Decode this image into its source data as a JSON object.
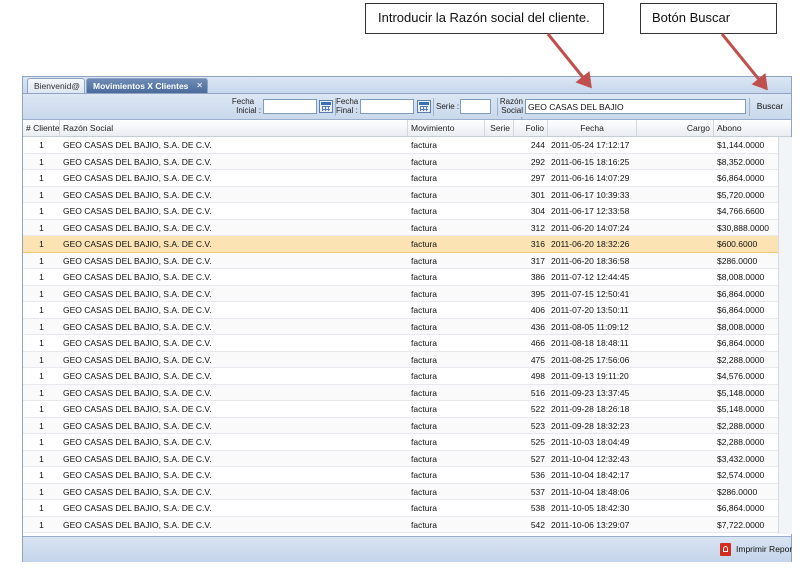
{
  "callouts": {
    "razon_hint": "Introducir la Razón social del cliente.",
    "buscar_hint": "Botón Buscar"
  },
  "tabs": [
    {
      "label": "Bienvenid@"
    },
    {
      "label": "Movimientos X Clientes",
      "close": "✕"
    }
  ],
  "toolbar": {
    "fecha_inicial_label": [
      "Fecha",
      "Inicial :"
    ],
    "fecha_final_label": [
      "Fecha",
      "Final :"
    ],
    "serie_label": "Serie :",
    "razon_label": [
      "Razón",
      "Social :"
    ],
    "fecha_inicial_value": "",
    "fecha_final_value": "",
    "serie_value": "",
    "razon_value": "GEO CASAS DEL BAJIO",
    "buscar_label": "Buscar"
  },
  "columns": {
    "cliente": "# Cliente",
    "razon": "Razón Social",
    "movimiento": "Movimiento",
    "serie": "Serie",
    "folio": "Folio",
    "fecha": "Fecha",
    "cargo": "Cargo",
    "abono": "Abono"
  },
  "rows": [
    {
      "cliente": "1",
      "razon": "GEO CASAS DEL BAJIO, S.A. DE C.V.",
      "movimiento": "factura",
      "serie": "",
      "folio": "244",
      "fecha": "2011-05-24 17:12:17",
      "cargo": "",
      "abono": "$1,144.0000"
    },
    {
      "cliente": "1",
      "razon": "GEO CASAS DEL BAJIO, S.A. DE C.V.",
      "movimiento": "factura",
      "serie": "",
      "folio": "292",
      "fecha": "2011-06-15 18:16:25",
      "cargo": "",
      "abono": "$8,352.0000"
    },
    {
      "cliente": "1",
      "razon": "GEO CASAS DEL BAJIO, S.A. DE C.V.",
      "movimiento": "factura",
      "serie": "",
      "folio": "297",
      "fecha": "2011-06-16 14:07:29",
      "cargo": "",
      "abono": "$6,864.0000"
    },
    {
      "cliente": "1",
      "razon": "GEO CASAS DEL BAJIO, S.A. DE C.V.",
      "movimiento": "factura",
      "serie": "",
      "folio": "301",
      "fecha": "2011-06-17 10:39:33",
      "cargo": "",
      "abono": "$5,720.0000"
    },
    {
      "cliente": "1",
      "razon": "GEO CASAS DEL BAJIO, S.A. DE C.V.",
      "movimiento": "factura",
      "serie": "",
      "folio": "304",
      "fecha": "2011-06-17 12:33:58",
      "cargo": "",
      "abono": "$4,766.6600"
    },
    {
      "cliente": "1",
      "razon": "GEO CASAS DEL BAJIO, S.A. DE C.V.",
      "movimiento": "factura",
      "serie": "",
      "folio": "312",
      "fecha": "2011-06-20 14:07:24",
      "cargo": "",
      "abono": "$30,888.0000"
    },
    {
      "cliente": "1",
      "razon": "GEO CASAS DEL BAJIO, S.A. DE C.V.",
      "movimiento": "factura",
      "serie": "",
      "folio": "316",
      "fecha": "2011-06-20 18:32:26",
      "cargo": "",
      "abono": "$600.6000",
      "selected": true
    },
    {
      "cliente": "1",
      "razon": "GEO CASAS DEL BAJIO, S.A. DE C.V.",
      "movimiento": "factura",
      "serie": "",
      "folio": "317",
      "fecha": "2011-06-20 18:36:58",
      "cargo": "",
      "abono": "$286.0000"
    },
    {
      "cliente": "1",
      "razon": "GEO CASAS DEL BAJIO, S.A. DE C.V.",
      "movimiento": "factura",
      "serie": "",
      "folio": "386",
      "fecha": "2011-07-12 12:44:45",
      "cargo": "",
      "abono": "$8,008.0000"
    },
    {
      "cliente": "1",
      "razon": "GEO CASAS DEL BAJIO, S.A. DE C.V.",
      "movimiento": "factura",
      "serie": "",
      "folio": "395",
      "fecha": "2011-07-15 12:50:41",
      "cargo": "",
      "abono": "$6,864.0000"
    },
    {
      "cliente": "1",
      "razon": "GEO CASAS DEL BAJIO, S.A. DE C.V.",
      "movimiento": "factura",
      "serie": "",
      "folio": "406",
      "fecha": "2011-07-20 13:50:11",
      "cargo": "",
      "abono": "$6,864.0000"
    },
    {
      "cliente": "1",
      "razon": "GEO CASAS DEL BAJIO, S.A. DE C.V.",
      "movimiento": "factura",
      "serie": "",
      "folio": "436",
      "fecha": "2011-08-05 11:09:12",
      "cargo": "",
      "abono": "$8,008.0000"
    },
    {
      "cliente": "1",
      "razon": "GEO CASAS DEL BAJIO, S.A. DE C.V.",
      "movimiento": "factura",
      "serie": "",
      "folio": "466",
      "fecha": "2011-08-18 18:48:11",
      "cargo": "",
      "abono": "$6,864.0000"
    },
    {
      "cliente": "1",
      "razon": "GEO CASAS DEL BAJIO, S.A. DE C.V.",
      "movimiento": "factura",
      "serie": "",
      "folio": "475",
      "fecha": "2011-08-25 17:56:06",
      "cargo": "",
      "abono": "$2,288.0000"
    },
    {
      "cliente": "1",
      "razon": "GEO CASAS DEL BAJIO, S.A. DE C.V.",
      "movimiento": "factura",
      "serie": "",
      "folio": "498",
      "fecha": "2011-09-13 19:11:20",
      "cargo": "",
      "abono": "$4,576.0000"
    },
    {
      "cliente": "1",
      "razon": "GEO CASAS DEL BAJIO, S.A. DE C.V.",
      "movimiento": "factura",
      "serie": "",
      "folio": "516",
      "fecha": "2011-09-23 13:37:45",
      "cargo": "",
      "abono": "$5,148.0000"
    },
    {
      "cliente": "1",
      "razon": "GEO CASAS DEL BAJIO, S.A. DE C.V.",
      "movimiento": "factura",
      "serie": "",
      "folio": "522",
      "fecha": "2011-09-28 18:26:18",
      "cargo": "",
      "abono": "$5,148.0000"
    },
    {
      "cliente": "1",
      "razon": "GEO CASAS DEL BAJIO, S.A. DE C.V.",
      "movimiento": "factura",
      "serie": "",
      "folio": "523",
      "fecha": "2011-09-28 18:32:23",
      "cargo": "",
      "abono": "$2,288.0000"
    },
    {
      "cliente": "1",
      "razon": "GEO CASAS DEL BAJIO, S.A. DE C.V.",
      "movimiento": "factura",
      "serie": "",
      "folio": "525",
      "fecha": "2011-10-03 18:04:49",
      "cargo": "",
      "abono": "$2,288.0000"
    },
    {
      "cliente": "1",
      "razon": "GEO CASAS DEL BAJIO, S.A. DE C.V.",
      "movimiento": "factura",
      "serie": "",
      "folio": "527",
      "fecha": "2011-10-04 12:32:43",
      "cargo": "",
      "abono": "$3,432.0000"
    },
    {
      "cliente": "1",
      "razon": "GEO CASAS DEL BAJIO, S.A. DE C.V.",
      "movimiento": "factura",
      "serie": "",
      "folio": "536",
      "fecha": "2011-10-04 18:42:17",
      "cargo": "",
      "abono": "$2,574.0000"
    },
    {
      "cliente": "1",
      "razon": "GEO CASAS DEL BAJIO, S.A. DE C.V.",
      "movimiento": "factura",
      "serie": "",
      "folio": "537",
      "fecha": "2011-10-04 18:48:06",
      "cargo": "",
      "abono": "$286.0000"
    },
    {
      "cliente": "1",
      "razon": "GEO CASAS DEL BAJIO, S.A. DE C.V.",
      "movimiento": "factura",
      "serie": "",
      "folio": "538",
      "fecha": "2011-10-05 18:42:30",
      "cargo": "",
      "abono": "$6,864.0000"
    },
    {
      "cliente": "1",
      "razon": "GEO CASAS DEL BAJIO, S.A. DE C.V.",
      "movimiento": "factura",
      "serie": "",
      "folio": "542",
      "fecha": "2011-10-06 13:29:07",
      "cargo": "",
      "abono": "$7,722.0000"
    }
  ],
  "footer": {
    "print_label": "Imprimir Repor",
    "print_icon": "pdf-icon"
  },
  "colors": {
    "arrow": "#c0504d",
    "selected_row": "#fbe3b3",
    "active_tab": "#4a6b9b"
  }
}
